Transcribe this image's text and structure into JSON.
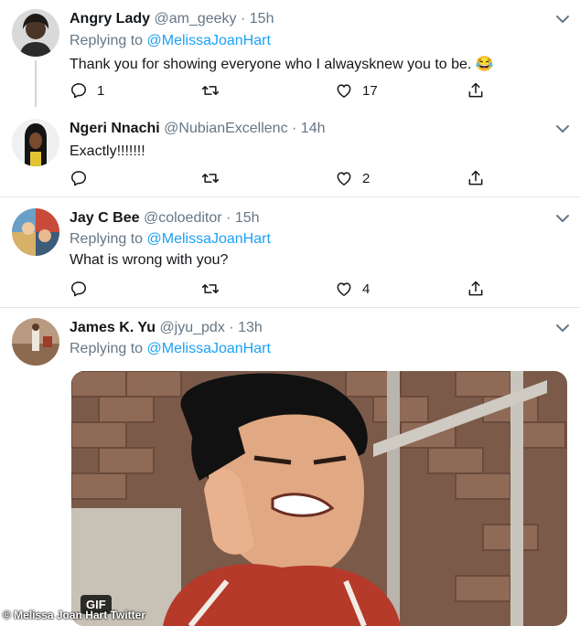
{
  "tweets": [
    {
      "name": "Angry Lady",
      "handle": "@am_geeky",
      "time": "15h",
      "replying_prefix": "Replying to ",
      "replying_to": "@MelissaJoanHart",
      "text": "Thank you for showing everyone who I alwaysknew you to be. 😂",
      "replies": "1",
      "retweets": "",
      "likes": "17"
    },
    {
      "name": "Ngeri Nnachi",
      "handle": "@NubianExcellenc",
      "time": "14h",
      "text": "Exactly!!!!!!!",
      "replies": "",
      "retweets": "",
      "likes": "2"
    },
    {
      "name": "Jay C Bee",
      "handle": "@coloeditor",
      "time": "15h",
      "replying_prefix": "Replying to ",
      "replying_to": "@MelissaJoanHart",
      "text": "What is wrong with you?",
      "replies": "",
      "retweets": "",
      "likes": "4"
    },
    {
      "name": "James K. Yu",
      "handle": "@jyu_pdx",
      "time": "13h",
      "replying_prefix": "Replying to ",
      "replying_to": "@MelissaJoanHart",
      "media_badge": "GIF"
    }
  ],
  "separator": "·",
  "watermark": "© Melissa Joan Hart Twitter",
  "icons": [
    "reply-icon",
    "retweet-icon",
    "like-icon",
    "share-icon",
    "chevron-down-icon"
  ],
  "colors": {
    "link": "#1da1f2",
    "secondary": "#657786",
    "divider": "#e1e8ed"
  }
}
